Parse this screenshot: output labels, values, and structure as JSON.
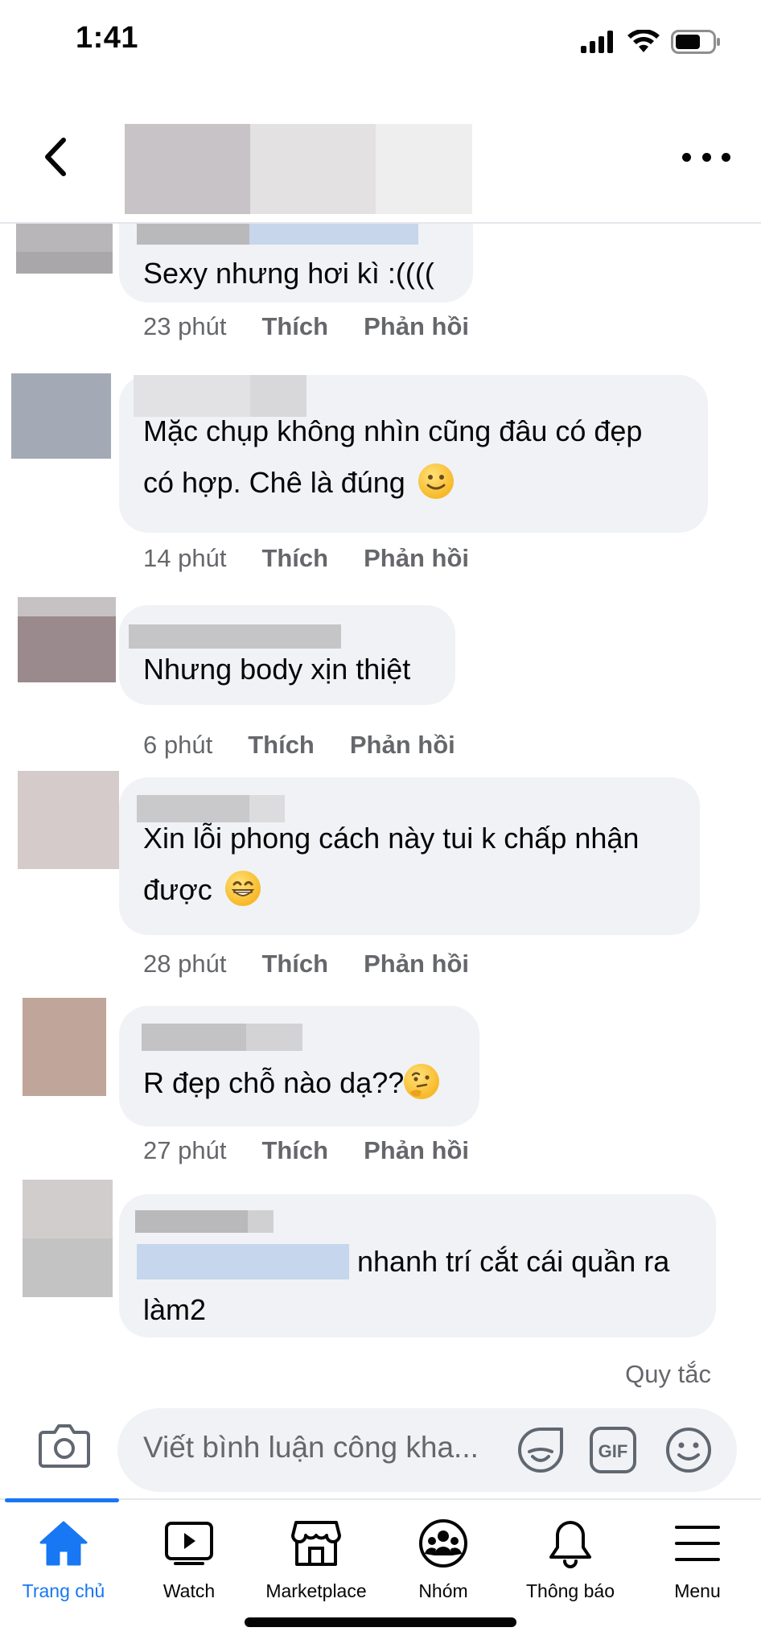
{
  "status_bar": {
    "time": "1:41"
  },
  "header": {
    "back_icon": "chevron-left-icon",
    "more_icon": "more-horizontal-icon"
  },
  "comments": [
    {
      "text": "Sexy nhưng hơi kì :((((",
      "time": "23 phút",
      "like": "Thích",
      "reply": "Phản hồi",
      "emoji": ""
    },
    {
      "text_line1": "Mặc chụp không nhìn cũng đâu có đẹp",
      "text_line2": "có hợp. Chê là đúng",
      "time": "14 phút",
      "like": "Thích",
      "reply": "Phản hồi",
      "emoji": "slightly-smiling-face"
    },
    {
      "text": "Nhưng body xịn thiệt",
      "time": "6 phút",
      "like": "Thích",
      "reply": "Phản hồi",
      "emoji": ""
    },
    {
      "text_line1": "Xin lỗi phong cách này tui k chấp nhận",
      "text_line2": "được",
      "time": "28 phút",
      "like": "Thích",
      "reply": "Phản hồi",
      "emoji": "grinning-face"
    },
    {
      "text": "R đẹp chỗ nào dạ??",
      "time": "27 phút",
      "like": "Thích",
      "reply": "Phản hồi",
      "emoji": "thinking-face"
    },
    {
      "text_line1": "nhanh trí cắt cái quần ra",
      "text_line2": "làm2"
    }
  ],
  "composer": {
    "rules": "Quy tắc",
    "placeholder": "Viết bình luận công kha...",
    "gif_label": "GIF",
    "icons": [
      "camera-icon",
      "avatar-sticker-icon",
      "gif-icon",
      "emoji-icon"
    ]
  },
  "bottom_nav": {
    "items": [
      {
        "label": "Trang chủ",
        "icon": "home-icon",
        "active": true
      },
      {
        "label": "Watch",
        "icon": "watch-icon"
      },
      {
        "label": "Marketplace",
        "icon": "marketplace-icon"
      },
      {
        "label": "Nhóm",
        "icon": "groups-icon"
      },
      {
        "label": "Thông báo",
        "icon": "notifications-icon"
      },
      {
        "label": "Menu",
        "icon": "menu-icon"
      }
    ]
  },
  "colors": {
    "accent": "#1877f2",
    "bubble": "#f0f2f5",
    "meta_text": "#65676b",
    "text": "#050505"
  }
}
